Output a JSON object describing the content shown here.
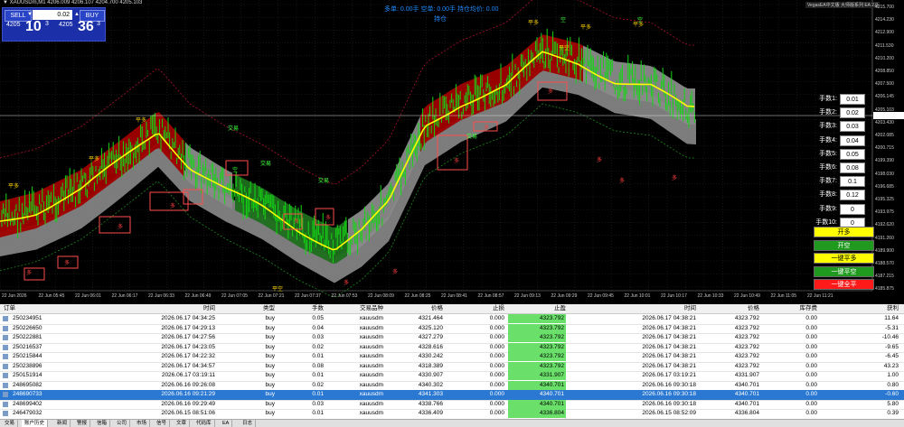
{
  "window": {
    "symbol_title": "▼ XAUUSDm,M1  4206.009 4206.107 4204.700 4205.103"
  },
  "trade_panel": {
    "sell_label": "SELL",
    "buy_label": "BUY",
    "lot": "0.02",
    "sell_price_small": "4205",
    "sell_price_big": "10",
    "sell_price_sup": "3",
    "buy_price_small": "4205",
    "buy_price_big": "36",
    "buy_price_sup": "3"
  },
  "top_info": {
    "line1": "多单: 0.00手  空单: 0.00手  持仓均价: 0.00",
    "line2": "持仓"
  },
  "top_right_label": "VegasEA中文版 大师版系列 EA 2.0",
  "price_axis": [
    "4215.700",
    "4214.230",
    "4212.900",
    "4211.530",
    "4210.200",
    "4208.850",
    "4207.500",
    "4206.145",
    "4205.103",
    "4203.430",
    "4202.085",
    "4200.715",
    "4199.390",
    "4198.030",
    "4196.685",
    "4195.325",
    "4193.975",
    "4192.620",
    "4191.260",
    "4189.900",
    "4188.570",
    "4187.215",
    "4185.875"
  ],
  "time_axis": [
    "22 Jun 2026",
    "22 Jun 05:45",
    "22 Jun 06:01",
    "22 Jun 06:17",
    "22 Jun 06:33",
    "22 Jun 06:49",
    "22 Jun 07:05",
    "22 Jun 07:21",
    "22 Jun 07:37",
    "22 Jun 07:53",
    "22 Jun 08:09",
    "22 Jun 08:25",
    "22 Jun 08:41",
    "22 Jun 08:57",
    "22 Jun 09:13",
    "22 Jun 09:29",
    "22 Jun 09:45",
    "22 Jun 10:01",
    "22 Jun 10:17",
    "22 Jun 10:33",
    "22 Jun 10:49",
    "22 Jun 11:05",
    "22 Jun 11:21"
  ],
  "chart_labels": {
    "flat_long": "平多",
    "flat_short": "平空",
    "trade_in": "交易",
    "long": "多",
    "short": "空"
  },
  "lot_panel": [
    {
      "label": "手数1:",
      "value": "0.01"
    },
    {
      "label": "手数2:",
      "value": "0.02"
    },
    {
      "label": "手数3:",
      "value": "0.03"
    },
    {
      "label": "手数4:",
      "value": "0.04"
    },
    {
      "label": "手数5:",
      "value": "0.05"
    },
    {
      "label": "手数6:",
      "value": "0.08"
    },
    {
      "label": "手数7:",
      "value": "0.1"
    },
    {
      "label": "手数8:",
      "value": "0.12"
    },
    {
      "label": "手数9:",
      "value": "0"
    },
    {
      "label": "手数10:",
      "value": "0"
    }
  ],
  "action_buttons": [
    {
      "label": "开多",
      "bg": "#ffff00",
      "fg": "#000000"
    },
    {
      "label": "开空",
      "bg": "#1f9a1f",
      "fg": "#ffffff"
    },
    {
      "label": "一键平多",
      "bg": "#ffff00",
      "fg": "#000000"
    },
    {
      "label": "一键平空",
      "bg": "#1f9a1f",
      "fg": "#ffffff"
    },
    {
      "label": "一键全平",
      "bg": "#ff1a1a",
      "fg": "#ffffff"
    }
  ],
  "orders": {
    "headers": {
      "order": "订单",
      "time": "时间",
      "type": "类型",
      "lots": "手数",
      "symbol": "交易品种",
      "price": "价格",
      "sl": "止损",
      "tp": "止盈",
      "time2": "时间",
      "price2": "价格",
      "swap": "库存费",
      "profit": "获利"
    },
    "rows": [
      {
        "id": "250234951",
        "time": "2026.06.17 04:34:25",
        "type": "buy",
        "lots": "0.05",
        "symbol": "xauusdm",
        "price": "4321.464",
        "sl": "0.000",
        "tp": "4323.792",
        "time2": "2026.06.17 04:38:21",
        "price2": "4323.792",
        "swap": "0.00",
        "profit": "11.64",
        "selected": false
      },
      {
        "id": "250226650",
        "time": "2026.06.17 04:29:13",
        "type": "buy",
        "lots": "0.04",
        "symbol": "xauusdm",
        "price": "4325.120",
        "sl": "0.000",
        "tp": "4323.792",
        "time2": "2026.06.17 04:38:21",
        "price2": "4323.792",
        "swap": "0.00",
        "profit": "-5.31",
        "selected": false
      },
      {
        "id": "250222881",
        "time": "2026.06.17 04:27:56",
        "type": "buy",
        "lots": "0.03",
        "symbol": "xauusdm",
        "price": "4327.279",
        "sl": "0.000",
        "tp": "4323.792",
        "time2": "2026.06.17 04:38:21",
        "price2": "4323.792",
        "swap": "0.00",
        "profit": "-10.46",
        "selected": false
      },
      {
        "id": "250216537",
        "time": "2026.06.17 04:23:05",
        "type": "buy",
        "lots": "0.02",
        "symbol": "xauusdm",
        "price": "4328.616",
        "sl": "0.000",
        "tp": "4323.792",
        "time2": "2026.06.17 04:38:21",
        "price2": "4323.792",
        "swap": "0.00",
        "profit": "-9.65",
        "selected": false
      },
      {
        "id": "250215844",
        "time": "2026.06.17 04:22:32",
        "type": "buy",
        "lots": "0.01",
        "symbol": "xauusdm",
        "price": "4330.242",
        "sl": "0.000",
        "tp": "4323.792",
        "time2": "2026.06.17 04:38:21",
        "price2": "4323.792",
        "swap": "0.00",
        "profit": "-6.45",
        "selected": false
      },
      {
        "id": "250238896",
        "time": "2026.06.17 04:34:57",
        "type": "buy",
        "lots": "0.08",
        "symbol": "xauusdm",
        "price": "4318.389",
        "sl": "0.000",
        "tp": "4323.792",
        "time2": "2026.06.17 04:38:21",
        "price2": "4323.792",
        "swap": "0.00",
        "profit": "43.23",
        "selected": false
      },
      {
        "id": "250151914",
        "time": "2026.06.17 03:19:11",
        "type": "buy",
        "lots": "0.01",
        "symbol": "xauusdm",
        "price": "4330.907",
        "sl": "0.000",
        "tp": "4331.907",
        "time2": "2026.06.17 03:19:21",
        "price2": "4331.907",
        "swap": "0.00",
        "profit": "1.00",
        "selected": false
      },
      {
        "id": "248695082",
        "time": "2026.06.16 09:26:08",
        "type": "buy",
        "lots": "0.02",
        "symbol": "xauusdm",
        "price": "4340.302",
        "sl": "0.000",
        "tp": "4340.701",
        "time2": "2026.06.16 09:30:18",
        "price2": "4340.701",
        "swap": "0.00",
        "profit": "0.80",
        "selected": false
      },
      {
        "id": "248690733",
        "time": "2026.06.16 09:21:29",
        "type": "buy",
        "lots": "0.01",
        "symbol": "xauusdm",
        "price": "4341.303",
        "sl": "0.000",
        "tp": "4340.701",
        "time2": "2026.06.16 09:30:18",
        "price2": "4340.701",
        "swap": "0.00",
        "profit": "-0.60",
        "selected": true
      },
      {
        "id": "248699402",
        "time": "2026.06.16 09:29:49",
        "type": "buy",
        "lots": "0.03",
        "symbol": "xauusdm",
        "price": "4338.766",
        "sl": "0.000",
        "tp": "4340.701",
        "time2": "2026.06.16 09:30:18",
        "price2": "4340.701",
        "swap": "0.00",
        "profit": "5.80",
        "selected": false
      },
      {
        "id": "246479032",
        "time": "2026.06.15 08:51:06",
        "type": "buy",
        "lots": "0.01",
        "symbol": "xauusdm",
        "price": "4336.409",
        "sl": "0.000",
        "tp": "4336.804",
        "time2": "2026.06.15 08:52:09",
        "price2": "4336.804",
        "swap": "0.00",
        "profit": "0.39",
        "selected": false
      }
    ]
  },
  "bottom_tabs": [
    "交易",
    "账户历史",
    "新闻",
    "警报",
    "信箱",
    "公司",
    "市场",
    "信号",
    "文章",
    "代码库",
    "EA",
    "日志"
  ],
  "colors": {
    "bull_cloud": "#a00000",
    "bear_cloud": "#1e6f1e",
    "grey_band": "#8a8a8a",
    "candle": "#14d614",
    "ma_line": "#ffff00",
    "selected_row": "#2a78d2"
  }
}
